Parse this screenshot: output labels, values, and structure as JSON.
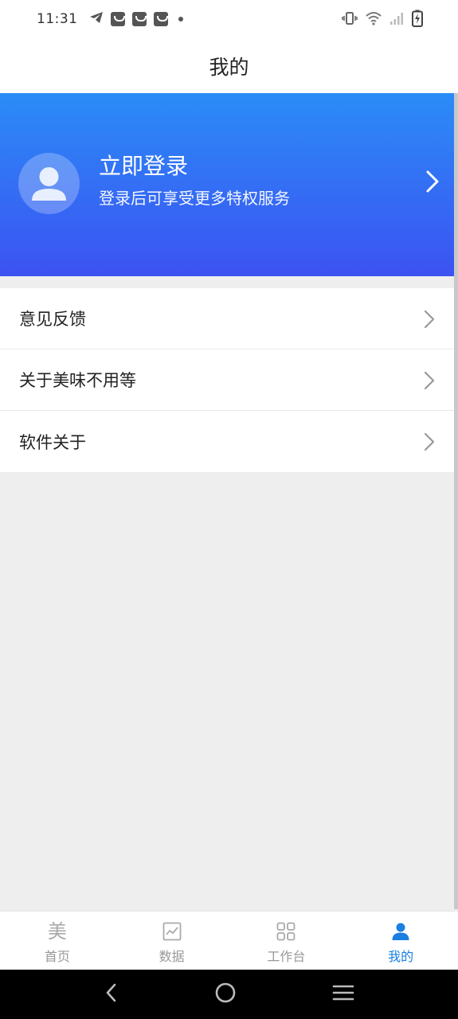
{
  "status_bar": {
    "time": "11:31",
    "icons": [
      "telegram-icon",
      "notification-icon",
      "notification-icon",
      "notification-icon",
      "dot-icon",
      "vibrate-icon",
      "wifi-icon",
      "signal-icon",
      "battery-charging-icon"
    ]
  },
  "header": {
    "title": "我的"
  },
  "profile": {
    "title": "立即登录",
    "subtitle": "登录后可享受更多特权服务",
    "avatar_icon": "user-avatar-icon"
  },
  "menu": [
    {
      "label": "意见反馈"
    },
    {
      "label": "关于美味不用等"
    },
    {
      "label": "软件关于"
    }
  ],
  "tabs": [
    {
      "label": "首页",
      "icon": "home-mei-icon",
      "glyph": "美",
      "active": false
    },
    {
      "label": "数据",
      "icon": "chart-icon",
      "active": false
    },
    {
      "label": "工作台",
      "icon": "grid-icon",
      "active": false
    },
    {
      "label": "我的",
      "icon": "person-icon",
      "active": true
    }
  ],
  "colors": {
    "banner_top": "#2b8cf7",
    "banner_bottom": "#3c52f2",
    "active_tab": "#1a7fe0",
    "inactive_tab": "#999999",
    "background": "#eeeeee"
  }
}
